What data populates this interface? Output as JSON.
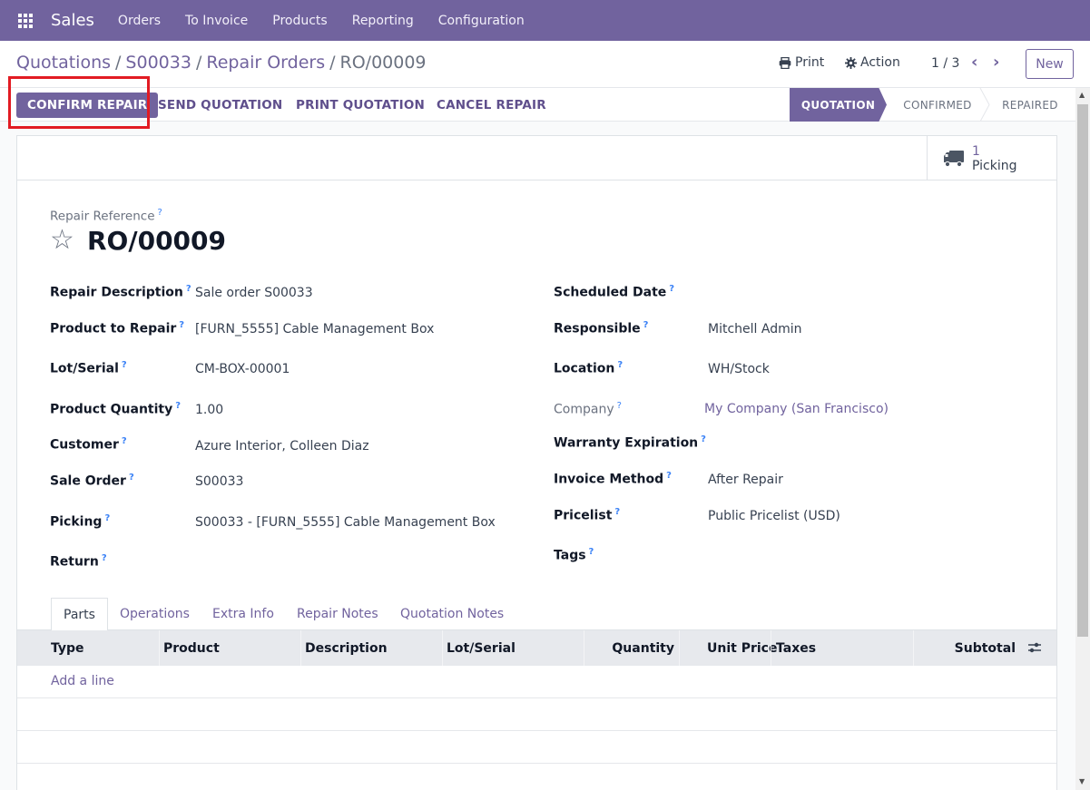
{
  "navbar": {
    "app_name": "Sales",
    "items": [
      "Orders",
      "To Invoice",
      "Products",
      "Reporting",
      "Configuration"
    ]
  },
  "breadcrumb": {
    "items": [
      "Quotations",
      "S00033",
      "Repair Orders"
    ],
    "current": "RO/00009"
  },
  "control": {
    "print_label": "Print",
    "action_label": "Action",
    "pager": "1 / 3",
    "new_label": "New"
  },
  "actions": {
    "confirm": "CONFIRM REPAIR",
    "send": "SEND QUOTATION",
    "print": "PRINT QUOTATION",
    "cancel": "CANCEL REPAIR"
  },
  "stages": {
    "active": "QUOTATION",
    "confirmed": "CONFIRMED",
    "repaired": "REPAIRED"
  },
  "smart_button": {
    "count": "1",
    "label": "Picking"
  },
  "record": {
    "ref_label": "Repair Reference",
    "name": "RO/00009"
  },
  "fields_left": {
    "repair_description": {
      "label": "Repair Description",
      "value": "Sale order S00033"
    },
    "product_to_repair": {
      "label": "Product to Repair",
      "value": "[FURN_5555] Cable Management Box"
    },
    "lot_serial": {
      "label": "Lot/Serial",
      "value": "CM-BOX-00001"
    },
    "product_quantity": {
      "label": "Product Quantity",
      "value": "1.00"
    },
    "customer": {
      "label": "Customer",
      "value": "Azure Interior, Colleen Diaz"
    },
    "sale_order": {
      "label": "Sale Order",
      "value": "S00033"
    },
    "picking": {
      "label": "Picking",
      "value": "S00033 - [FURN_5555] Cable Management Box"
    },
    "return": {
      "label": "Return",
      "value": ""
    }
  },
  "fields_right": {
    "scheduled_date": {
      "label": "Scheduled Date",
      "value": ""
    },
    "responsible": {
      "label": "Responsible",
      "value": "Mitchell Admin"
    },
    "location": {
      "label": "Location",
      "value": "WH/Stock"
    },
    "company": {
      "label": "Company",
      "value": "My Company (San Francisco)"
    },
    "warranty_expiration": {
      "label": "Warranty Expiration",
      "value": ""
    },
    "invoice_method": {
      "label": "Invoice Method",
      "value": "After Repair"
    },
    "pricelist": {
      "label": "Pricelist",
      "value": "Public Pricelist (USD)"
    },
    "tags": {
      "label": "Tags",
      "value": ""
    }
  },
  "tabs": [
    "Parts",
    "Operations",
    "Extra Info",
    "Repair Notes",
    "Quotation Notes"
  ],
  "table": {
    "columns": [
      "Type",
      "Product",
      "Description",
      "Lot/Serial",
      "Quantity",
      "Unit Price",
      "Taxes",
      "Subtotal"
    ],
    "add_line": "Add a line"
  },
  "colors": {
    "brand": "#71639e",
    "highlight": "#e21b23"
  }
}
